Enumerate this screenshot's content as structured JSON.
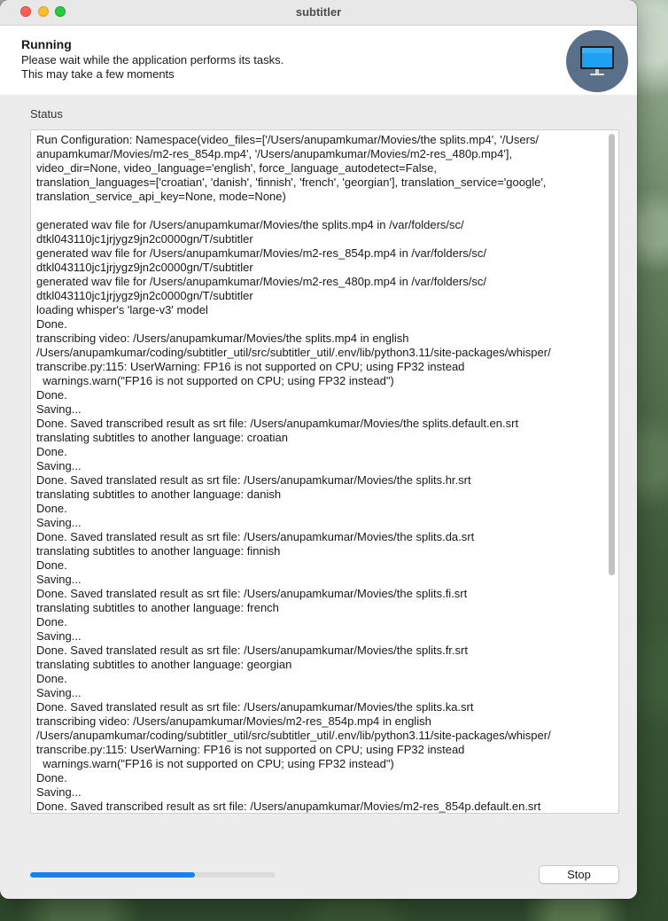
{
  "window": {
    "title": "subtitler"
  },
  "header": {
    "title": "Running",
    "line1": "Please wait while the application performs its tasks.",
    "line2": "This may take a few moments",
    "icon": "monitor-icon"
  },
  "status": {
    "label": "Status",
    "log_lines": [
      "Run Configuration: Namespace(video_files=['/Users/anupamkumar/Movies/the splits.mp4', '/Users/",
      "anupamkumar/Movies/m2-res_854p.mp4', '/Users/anupamkumar/Movies/m2-res_480p.mp4'],",
      "video_dir=None, video_language='english', force_language_autodetect=False,",
      "translation_languages=['croatian', 'danish', 'finnish', 'french', 'georgian'], translation_service='google',",
      "translation_service_api_key=None, mode=None)",
      "",
      "generated wav file for /Users/anupamkumar/Movies/the splits.mp4 in /var/folders/sc/",
      "dtkl043110jc1jrjygz9jn2c0000gn/T/subtitler",
      "generated wav file for /Users/anupamkumar/Movies/m2-res_854p.mp4 in /var/folders/sc/",
      "dtkl043110jc1jrjygz9jn2c0000gn/T/subtitler",
      "generated wav file for /Users/anupamkumar/Movies/m2-res_480p.mp4 in /var/folders/sc/",
      "dtkl043110jc1jrjygz9jn2c0000gn/T/subtitler",
      "loading whisper's 'large-v3' model",
      "Done.",
      "transcribing video: /Users/anupamkumar/Movies/the splits.mp4 in english",
      "/Users/anupamkumar/coding/subtitler_util/src/subtitler_util/.env/lib/python3.11/site-packages/whisper/",
      "transcribe.py:115: UserWarning: FP16 is not supported on CPU; using FP32 instead",
      "  warnings.warn(\"FP16 is not supported on CPU; using FP32 instead\")",
      "Done.",
      "Saving...",
      "Done. Saved transcribed result as srt file: /Users/anupamkumar/Movies/the splits.default.en.srt",
      "translating subtitles to another language: croatian",
      "Done.",
      "Saving...",
      "Done. Saved translated result as srt file: /Users/anupamkumar/Movies/the splits.hr.srt",
      "translating subtitles to another language: danish",
      "Done.",
      "Saving...",
      "Done. Saved translated result as srt file: /Users/anupamkumar/Movies/the splits.da.srt",
      "translating subtitles to another language: finnish",
      "Done.",
      "Saving...",
      "Done. Saved translated result as srt file: /Users/anupamkumar/Movies/the splits.fi.srt",
      "translating subtitles to another language: french",
      "Done.",
      "Saving...",
      "Done. Saved translated result as srt file: /Users/anupamkumar/Movies/the splits.fr.srt",
      "translating subtitles to another language: georgian",
      "Done.",
      "Saving...",
      "Done. Saved translated result as srt file: /Users/anupamkumar/Movies/the splits.ka.srt",
      "transcribing video: /Users/anupamkumar/Movies/m2-res_854p.mp4 in english",
      "/Users/anupamkumar/coding/subtitler_util/src/subtitler_util/.env/lib/python3.11/site-packages/whisper/",
      "transcribe.py:115: UserWarning: FP16 is not supported on CPU; using FP32 instead",
      "  warnings.warn(\"FP16 is not supported on CPU; using FP32 instead\")",
      "Done.",
      "Saving...",
      "Done. Saved transcribed result as srt file: /Users/anupamkumar/Movies/m2-res_854p.default.en.srt"
    ]
  },
  "progress": {
    "fraction": 0.67,
    "color": "#1a7ef0"
  },
  "actions": {
    "stop_label": "Stop"
  }
}
